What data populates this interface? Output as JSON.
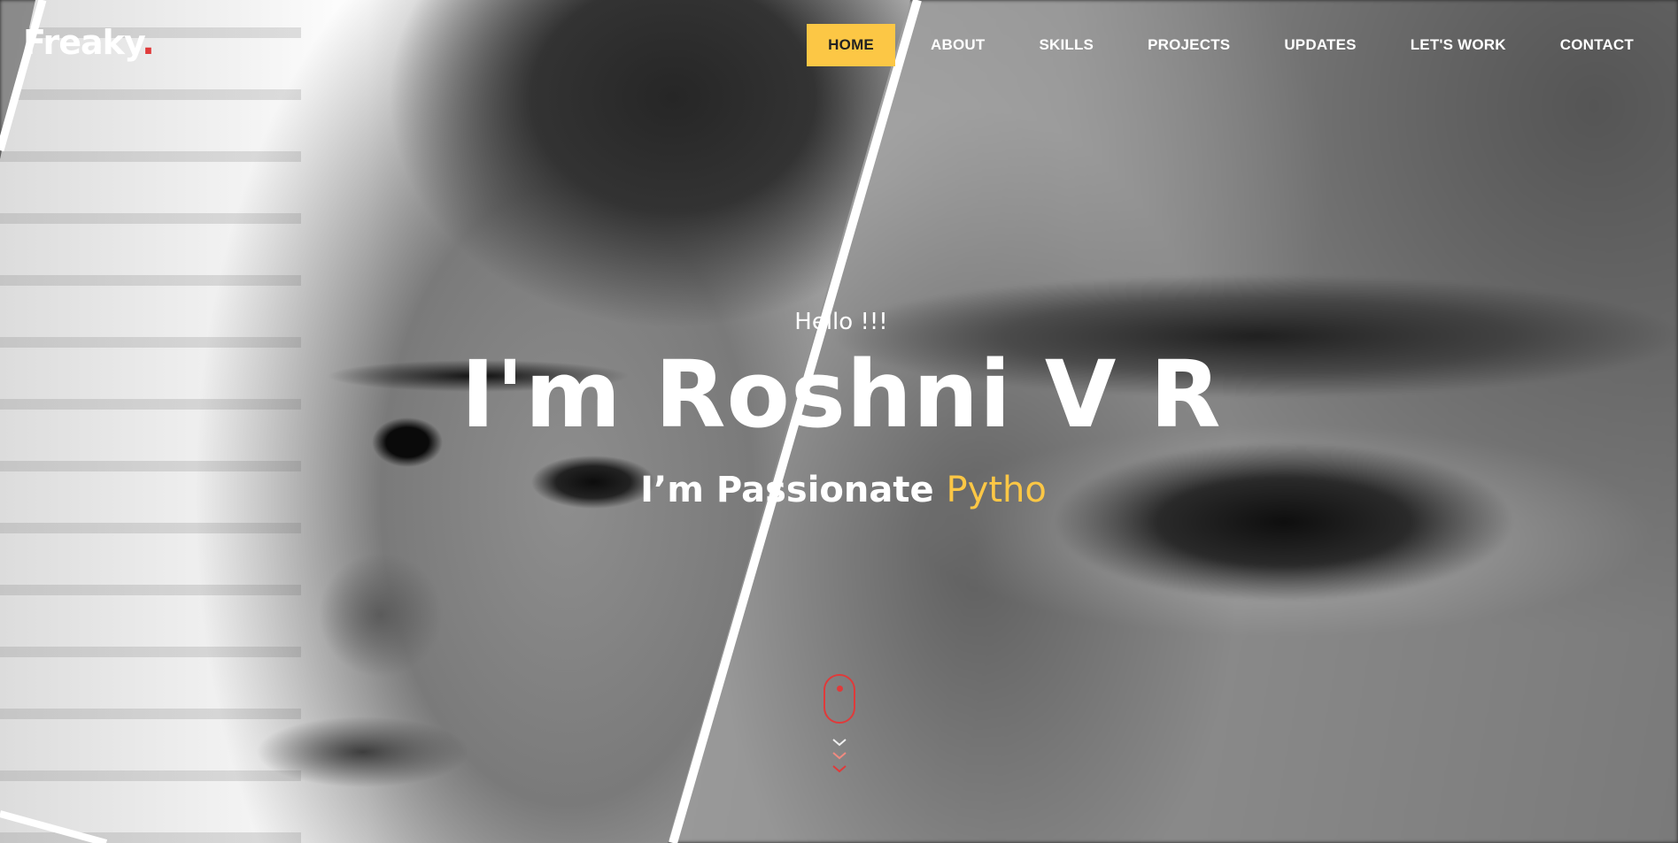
{
  "logo": {
    "text": "Freaky",
    "dot": "."
  },
  "nav": {
    "items": [
      {
        "label": "HOME",
        "active": true
      },
      {
        "label": "ABOUT",
        "active": false
      },
      {
        "label": "SKILLS",
        "active": false
      },
      {
        "label": "PROJECTS",
        "active": false
      },
      {
        "label": "UPDATES",
        "active": false
      },
      {
        "label": "LET'S WORK",
        "active": false
      },
      {
        "label": "CONTACT",
        "active": false
      }
    ]
  },
  "hero": {
    "greeting": "Hello !!!",
    "name": "I'm Roshni V R",
    "tagline_prefix": "I’m Passionate ",
    "tagline_typed": "Pytho"
  },
  "scroll_indicator": {
    "icon": "mouse-scroll-icon",
    "chevron_icon": "chevron-down-icon"
  },
  "colors": {
    "accent": "#fcc745",
    "brand_red": "#e03a3a",
    "text": "#ffffff"
  }
}
